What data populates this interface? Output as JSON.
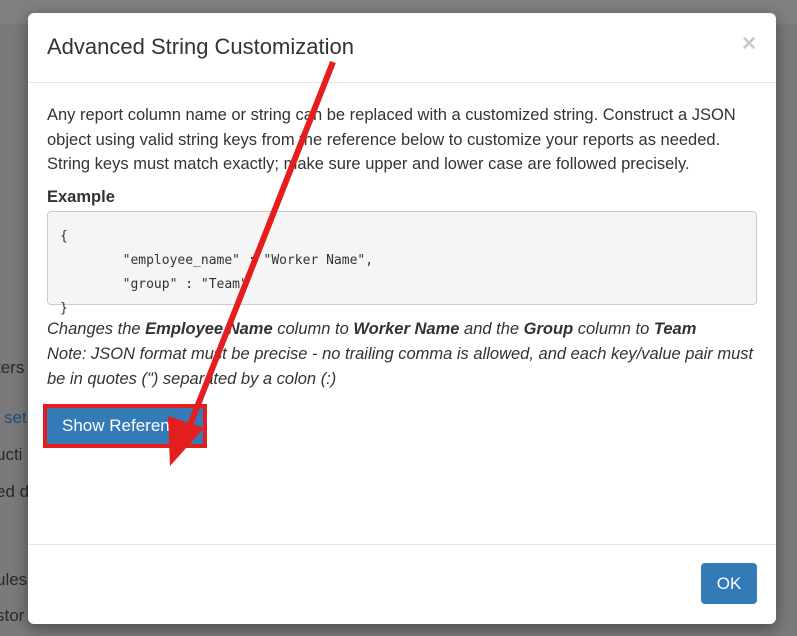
{
  "background": {
    "fragments": [
      "ters",
      "set",
      "ucti",
      "ed d",
      "ules",
      "stor"
    ]
  },
  "modal": {
    "title": "Advanced String Customization",
    "close_label": "×",
    "intro": "Any report column name or string can be replaced with a customized string. Construct a JSON object using valid string keys from the reference below to customize your reports as needed. String keys must match exactly; make sure upper and lower case are followed precisely.",
    "example_heading": "Example",
    "example_code": "{\n        \"employee_name\" : \"Worker Name\",\n        \"group\" : \"Team\"\n}",
    "changes": {
      "p1": "Changes the ",
      "b1": "Employee Name",
      "p2": " column to ",
      "b2": "Worker Name",
      "p3": " and the ",
      "b3": "Group",
      "p4": " column to ",
      "b4": "Team"
    },
    "note": "Note: JSON format must be precise - no trailing comma is allowed, and each key/value pair must be in quotes (\") separated by a colon (:)",
    "show_reference_label": "Show Reference",
    "ok_label": "OK"
  },
  "annotation": {
    "color": "#e41e1e"
  }
}
